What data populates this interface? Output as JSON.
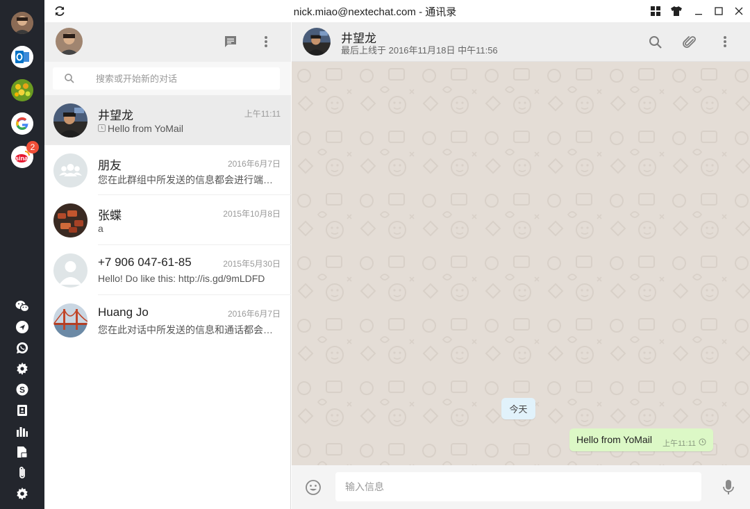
{
  "window": {
    "title": "nick.miao@nextechat.com - 通讯录"
  },
  "rail": {
    "accounts": [
      {
        "id": "profile",
        "icon": "profile-avatar"
      },
      {
        "id": "outlook",
        "icon": "outlook-logo",
        "color": "#0072c6"
      },
      {
        "id": "fruit-app",
        "icon": "fruit-app-logo"
      },
      {
        "id": "google",
        "icon": "google-logo"
      },
      {
        "id": "sina",
        "icon": "sina-weibo-logo",
        "badge": "2"
      }
    ],
    "tools": [
      "wechat-icon",
      "send-icon",
      "whatsapp-icon",
      "settings-gear-icon",
      "skype-icon",
      "contacts-book-icon",
      "bar-chart-icon",
      "document-icon",
      "attachment-icon",
      "gear-icon"
    ]
  },
  "search": {
    "placeholder": "搜索或开始新的对话"
  },
  "chats": [
    {
      "name": "井望龙",
      "time": "上午11:11",
      "preview": "Hello from YoMail",
      "active": true,
      "pending": true
    },
    {
      "name": "朋友",
      "time": "2016年6月7日",
      "preview": "您在此群组中所发送的信息都会进行端到...",
      "active": false
    },
    {
      "name": "张蝶",
      "time": "2015年10月8日",
      "preview": "a",
      "active": false
    },
    {
      "name": "+7 906 047-61-85",
      "time": "2015年5月30日",
      "preview": "Hello! Do like this: http://is.gd/9mLDFD",
      "active": false
    },
    {
      "name": "Huang Jo",
      "time": "2016年6月7日",
      "preview": "您在此对话中所发送的信息和通话都会进...",
      "active": false
    }
  ],
  "conversation": {
    "contact_name": "井望龙",
    "last_seen": "最后上线于 2016年11月18日 中午11:56",
    "date_chip": "今天",
    "messages": [
      {
        "text": "Hello from YoMail",
        "time": "上午11:11",
        "outgoing": true,
        "status": "clock-icon"
      }
    ],
    "composer_placeholder": "输入信息"
  },
  "colors": {
    "rail_bg": "#23262d",
    "header_bg": "#eeeeee",
    "chat_bg": "#e4ddd6",
    "outgoing_bubble": "#dcf8c6",
    "date_chip": "#e1f2fb",
    "badge": "#f04e37"
  }
}
